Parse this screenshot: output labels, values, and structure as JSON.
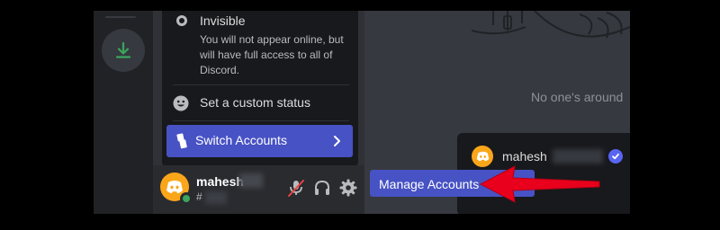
{
  "status_menu": {
    "invisible_title": "Invisible",
    "invisible_description": "You will not appear online, but will have full access to all of Discord.",
    "custom_status_label": "Set a custom status",
    "switch_accounts_label": "Switch Accounts"
  },
  "user_panel": {
    "username": "mahesh",
    "discriminator_prefix": "#"
  },
  "main": {
    "empty_state": "No one's around"
  },
  "account_switcher": {
    "account_name": "mahesh",
    "manage_label": "Manage Accounts"
  },
  "colors": {
    "blurple": "#4752c4",
    "avatar": "#faa61a",
    "online": "#3ba55c",
    "arrow": "#e8001c"
  },
  "icons": [
    "download-icon",
    "invisible-status-icon",
    "emoji-icon",
    "switch-accounts-icon",
    "chevron-right-icon",
    "discord-logo-icon",
    "mute-icon",
    "headphones-icon",
    "gear-icon",
    "check-icon",
    "arrow-annotation"
  ]
}
